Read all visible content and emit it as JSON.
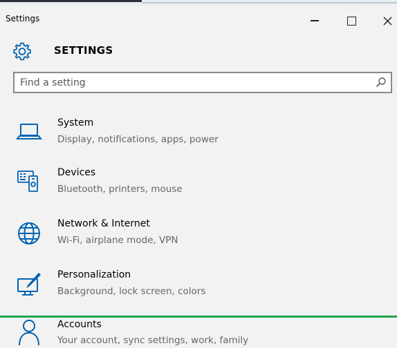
{
  "window": {
    "title": "Settings"
  },
  "header": {
    "title": "SETTINGS",
    "icon": "gear-icon"
  },
  "search": {
    "placeholder": "Find a setting",
    "value": ""
  },
  "items": [
    {
      "label": "System",
      "description": "Display, notifications, apps, power",
      "icon": "laptop-icon"
    },
    {
      "label": "Devices",
      "description": "Bluetooth, printers, mouse",
      "icon": "devices-icon"
    },
    {
      "label": "Network & Internet",
      "description": "Wi-Fi, airplane mode, VPN",
      "icon": "globe-icon"
    },
    {
      "label": "Personalization",
      "description": "Background, lock screen, colors",
      "icon": "personalization-icon"
    },
    {
      "label": "Accounts",
      "description": "Your account, sync settings, work, family",
      "icon": "person-icon"
    }
  ],
  "colors": {
    "accent": "#0063b1",
    "highlight": "#1aa34a",
    "background": "#f2f2f2"
  }
}
